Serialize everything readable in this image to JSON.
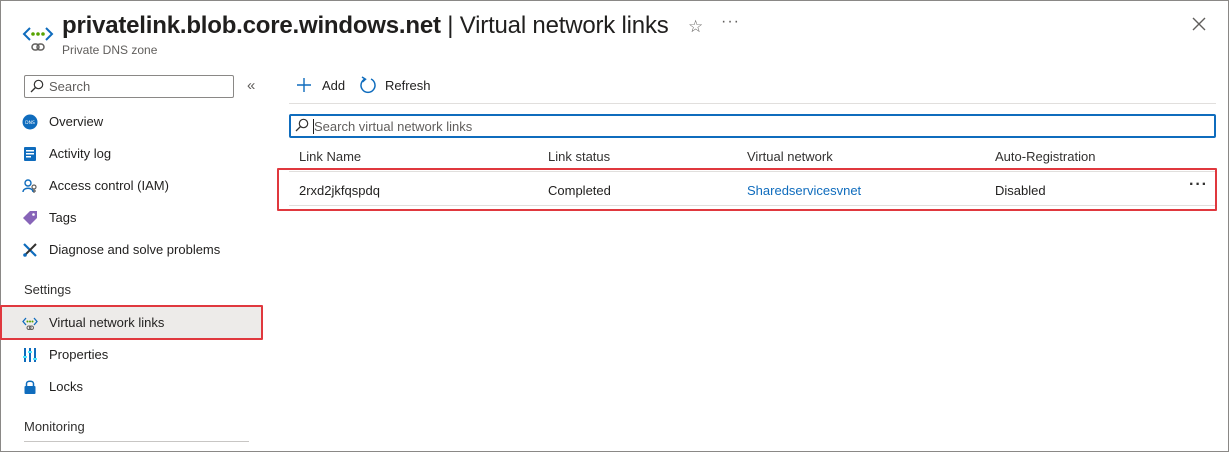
{
  "header": {
    "title_bold": "privatelink.blob.core.windows.net",
    "title_rest": " | Virtual network links",
    "subtitle": "Private DNS zone",
    "more": "···"
  },
  "sidebar": {
    "search_placeholder": "Search",
    "collapse": "«",
    "items": [
      {
        "label": "Overview",
        "icon": "dns-overview-icon"
      },
      {
        "label": "Activity log",
        "icon": "activity-log-icon"
      },
      {
        "label": "Access control (IAM)",
        "icon": "iam-icon"
      },
      {
        "label": "Tags",
        "icon": "tag-icon"
      },
      {
        "label": "Diagnose and solve problems",
        "icon": "wrench-icon"
      }
    ],
    "settings_label": "Settings",
    "settings_items": [
      {
        "label": "Virtual network links",
        "icon": "virtual-network-icon",
        "selected": true
      },
      {
        "label": "Properties",
        "icon": "properties-icon"
      },
      {
        "label": "Locks",
        "icon": "lock-icon"
      }
    ],
    "monitoring_label": "Monitoring"
  },
  "toolbar": {
    "add_label": "Add",
    "refresh_label": "Refresh"
  },
  "search": {
    "placeholder": "Search virtual network links"
  },
  "table": {
    "columns": [
      "Link Name",
      "Link status",
      "Virtual network",
      "Auto-Registration"
    ],
    "rows": [
      {
        "link_name": "2rxd2jkfqspdq",
        "link_status": "Completed",
        "virtual_network": "Sharedservicesvnet",
        "auto_registration": "Disabled",
        "more": "···"
      }
    ]
  },
  "colors": {
    "accent": "#0f6cbd",
    "highlight": "#e0383e",
    "selected_bg": "#edebe9"
  }
}
